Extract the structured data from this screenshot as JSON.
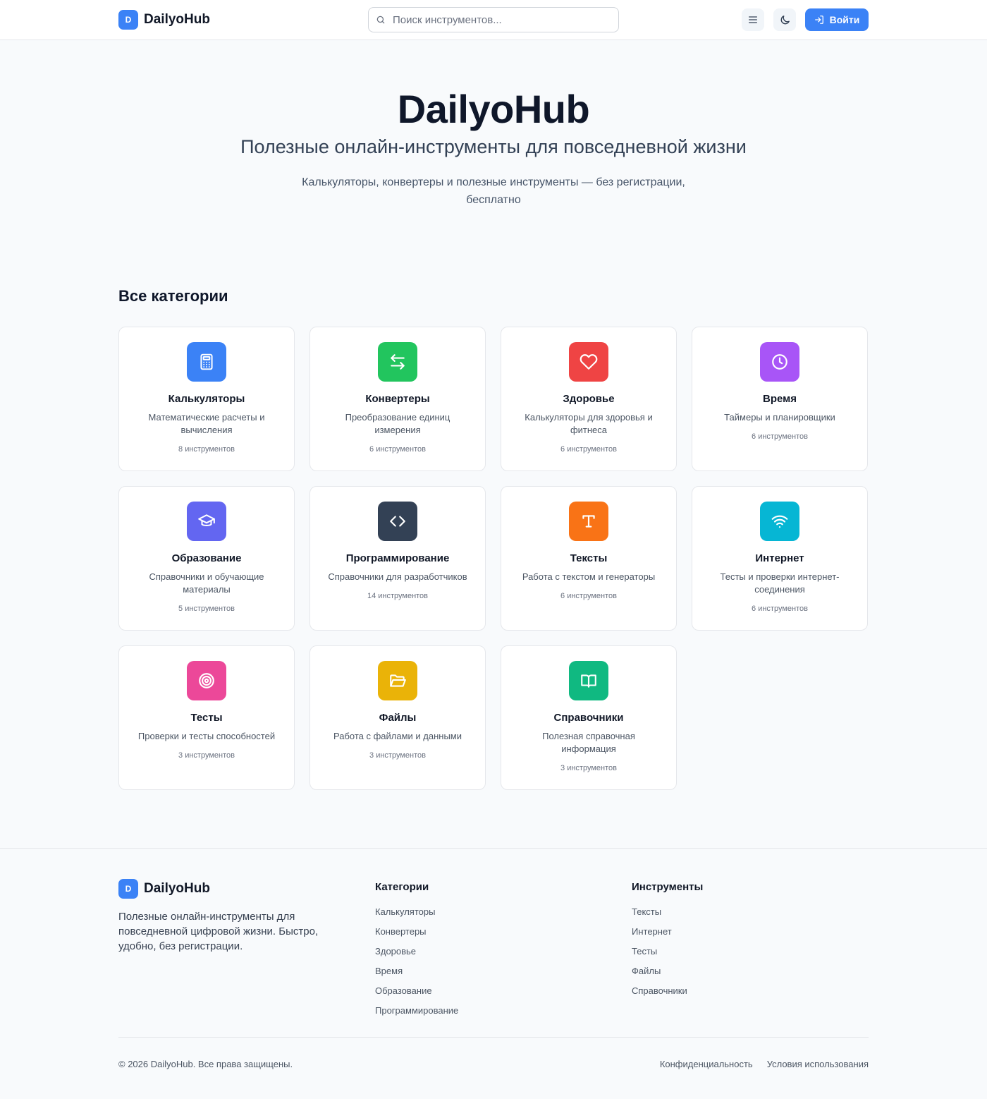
{
  "header": {
    "brand_letter": "D",
    "brand_name": "DailyoHub",
    "search_placeholder": "Поиск инструментов...",
    "login_label": "Войти"
  },
  "hero": {
    "title": "DailyoHub",
    "subtitle": "Полезные онлайн-инструменты для повседневной жизни",
    "description": "Калькуляторы, конвертеры и полезные инструменты — без регистрации, бесплатно"
  },
  "categories": {
    "heading": "Все категории",
    "items": [
      {
        "title": "Калькуляторы",
        "desc": "Математические расчеты и вычисления",
        "count": "8 инструментов",
        "color": "#3b82f6",
        "icon": "calculator-icon"
      },
      {
        "title": "Конвертеры",
        "desc": "Преобразование единиц измерения",
        "count": "6 инструментов",
        "color": "#22c55e",
        "icon": "arrows-exchange-icon"
      },
      {
        "title": "Здоровье",
        "desc": "Калькуляторы для здоровья и фитнеса",
        "count": "6 инструментов",
        "color": "#ef4444",
        "icon": "heart-icon"
      },
      {
        "title": "Время",
        "desc": "Таймеры и планировщики",
        "count": "6 инструментов",
        "color": "#a855f7",
        "icon": "clock-icon"
      },
      {
        "title": "Образование",
        "desc": "Справочники и обучающие материалы",
        "count": "5 инструментов",
        "color": "#6366f1",
        "icon": "graduation-cap-icon"
      },
      {
        "title": "Программирование",
        "desc": "Справочники для разработчиков",
        "count": "14 инструментов",
        "color": "#334155",
        "icon": "code-icon"
      },
      {
        "title": "Тексты",
        "desc": "Работа с текстом и генераторы",
        "count": "6 инструментов",
        "color": "#f97316",
        "icon": "text-type-icon"
      },
      {
        "title": "Интернет",
        "desc": "Тесты и проверки интернет-соединения",
        "count": "6 инструментов",
        "color": "#06b6d4",
        "icon": "wifi-icon"
      },
      {
        "title": "Тесты",
        "desc": "Проверки и тесты способностей",
        "count": "3 инструментов",
        "color": "#ec4899",
        "icon": "target-icon"
      },
      {
        "title": "Файлы",
        "desc": "Работа с файлами и данными",
        "count": "3 инструментов",
        "color": "#eab308",
        "icon": "folder-open-icon"
      },
      {
        "title": "Справочники",
        "desc": "Полезная справочная информация",
        "count": "3 инструментов",
        "color": "#10b981",
        "icon": "book-open-icon"
      }
    ]
  },
  "footer": {
    "brand_letter": "D",
    "brand_name": "DailyoHub",
    "description": "Полезные онлайн-инструменты для повседневной цифровой жизни. Быстро, удобно, без регистрации.",
    "col1": {
      "title": "Категории",
      "links": [
        "Калькуляторы",
        "Конвертеры",
        "Здоровье",
        "Время",
        "Образование",
        "Программирование"
      ]
    },
    "col2": {
      "title": "Инструменты",
      "links": [
        "Тексты",
        "Интернет",
        "Тесты",
        "Файлы",
        "Справочники"
      ]
    },
    "copyright": "© 2026 DailyoHub. Все права защищены.",
    "privacy": "Конфиденциальность",
    "terms": "Условия использования"
  }
}
